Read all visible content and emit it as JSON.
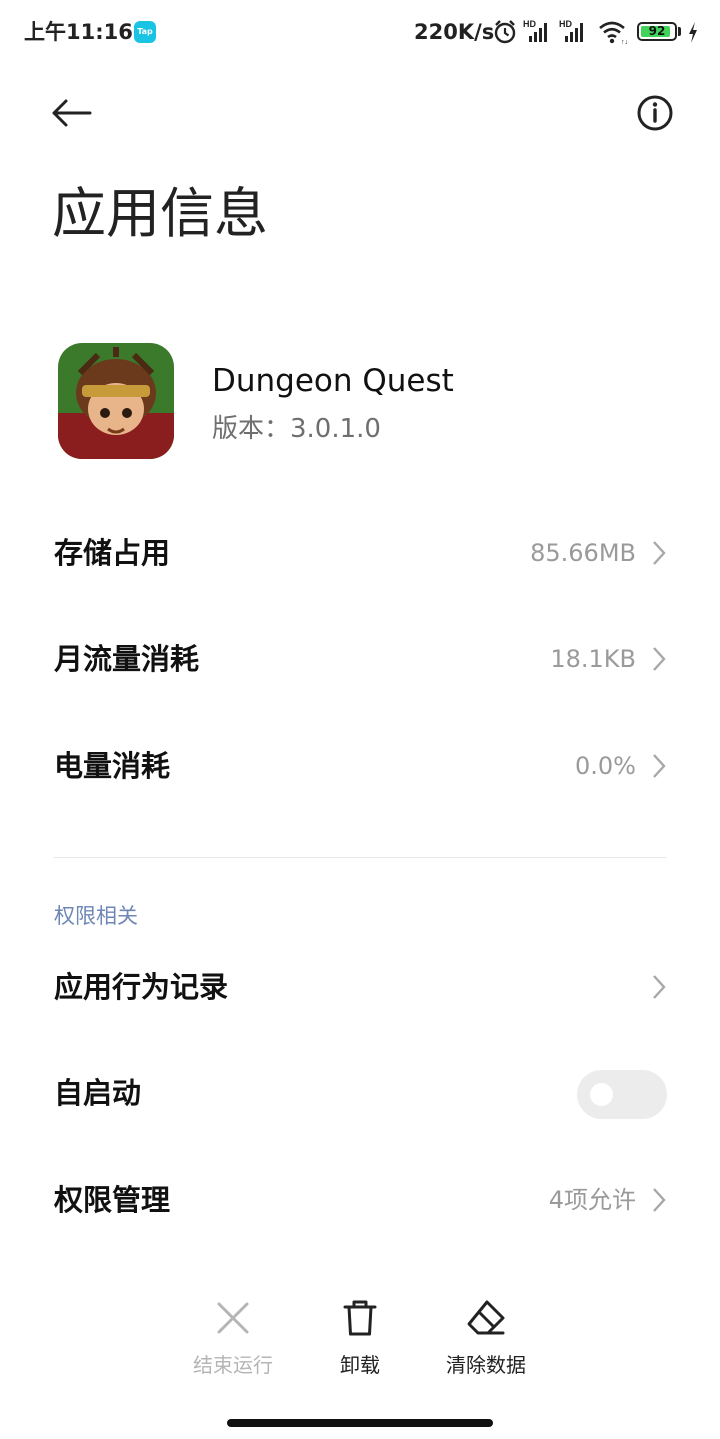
{
  "status_bar": {
    "time": "上午11:16",
    "tap_badge": "Tap",
    "net_speed": "220K/s",
    "battery_level": "92",
    "battery_percent": 92,
    "icons": [
      "alarm-icon",
      "hd-signal-icon",
      "hd-signal-icon",
      "wifi-icon",
      "battery-icon",
      "charging-icon"
    ]
  },
  "header": {
    "title": "应用信息",
    "back_icon": "back-arrow-icon",
    "info_icon": "info-icon"
  },
  "app": {
    "name": "Dungeon Quest",
    "version": "版本：3.0.1.0"
  },
  "rows": [
    {
      "label": "存储占用",
      "value": "85.66MB"
    },
    {
      "label": "月流量消耗",
      "value": "18.1KB"
    },
    {
      "label": "电量消耗",
      "value": "0.0%"
    }
  ],
  "permissions": {
    "section_title": "权限相关",
    "behavior_log": {
      "label": "应用行为记录"
    },
    "autostart": {
      "label": "自启动",
      "enabled": false
    },
    "manage": {
      "label": "权限管理",
      "value": "4项允许"
    }
  },
  "actions": {
    "stop": {
      "label": "结束运行",
      "icon": "close-icon",
      "enabled": false
    },
    "uninstall": {
      "label": "卸载",
      "icon": "trash-icon",
      "enabled": true
    },
    "clear": {
      "label": "清除数据",
      "icon": "eraser-icon",
      "enabled": true
    }
  },
  "colors": {
    "accent_section": "#6f87b7",
    "battery_fill": "#43d35b",
    "tap_badge": "#19c3e3"
  }
}
